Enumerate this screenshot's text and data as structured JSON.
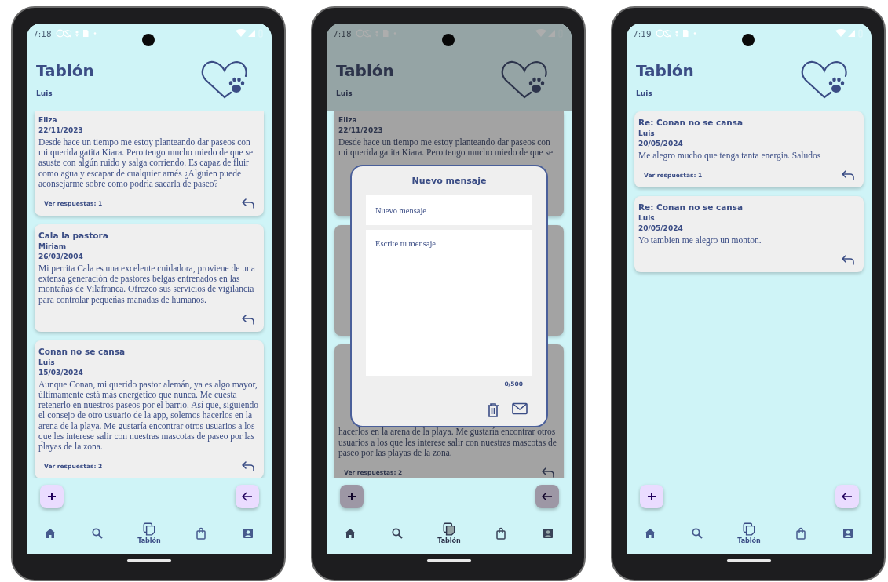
{
  "phones": [
    {
      "status_bar": {
        "time": "7:18"
      },
      "header": {
        "title": "Tablón",
        "user": "Luis"
      },
      "posts": [
        {
          "kind": "full",
          "author": "Eliza",
          "date": "22/11/2023",
          "body": "Desde hace un tiempo me estoy planteando dar paseos con mi querida gatita Kiara. Pero tengo mucho miedo de que se asuste con algún ruido y salga corriendo. Es capaz de fluir como agua y escapar de cualquier arnés ¿Alguien puede aconsejarme sobre como podría sacarla de paseo?",
          "replies": "Ver respuestas: 1"
        },
        {
          "kind": "full",
          "title": "Cala la pastora",
          "author": "Miriam",
          "date": "26/03/2004",
          "body": "Mi perrita Cala es una excelente cuidadora, proviene de una extensa generación de pastores belgas entrenados en las montañas de Vilafranca. Ofrezco sus servicios de vigilancia para controlar pequeñas manadas de humanos."
        },
        {
          "kind": "full",
          "title": "Conan no se cansa",
          "author": "Luis",
          "date": "15/03/2024",
          "body": "Aunque Conan, mi querido pastor alemán, ya es algo mayor, últimamente está más energético que nunca. Me cuesta retenerlo en nuestros paseos por el barrio. Así que, siguiendo el consejo de otro usuario de la app, solemos hacerlos en la arena de la playa. Me gustaría encontrar otros usuarios a los que les interese salir con nuestras mascotas de paseo por las playas de la zona.",
          "replies": "Ver respuestas: 2"
        }
      ],
      "nav": [
        {
          "kind": "home",
          "selected": false
        },
        {
          "kind": "search",
          "selected": false
        },
        {
          "kind": "board",
          "label": "Tablón",
          "selected": true
        },
        {
          "kind": "shop",
          "selected": false
        },
        {
          "kind": "profile",
          "selected": false
        }
      ]
    },
    {
      "status_bar": {
        "time": "7:18"
      },
      "header": {
        "title": "Tablón",
        "user": "Luis"
      },
      "posts": [
        {
          "kind": "top",
          "author": "Eliza",
          "date": "22/11/2023",
          "body": "Desde hace un tiempo me estoy planteando dar paseos con mi querida gatita Kiara. Pero tengo mucho miedo de que se"
        },
        {
          "kind": "covered"
        },
        {
          "kind": "bottom",
          "body": "hacerlos en la arena de la playa. Me gustaría encontrar otros usuarios a los que les interese salir con nuestras mascotas de paseo por las playas de la zona.",
          "replies": "Ver respuestas: 2"
        }
      ],
      "nav": [
        {
          "kind": "home",
          "selected": false
        },
        {
          "kind": "search",
          "selected": false
        },
        {
          "kind": "board",
          "label": "Tablón",
          "selected": true
        },
        {
          "kind": "shop",
          "selected": false
        },
        {
          "kind": "profile",
          "selected": false
        }
      ],
      "dialog": {
        "title": "Nuevo mensaje",
        "fields": [
          {
            "kind": "line",
            "placeholder": "Nuevo mensaje"
          },
          {
            "kind": "area",
            "placeholder": "Escrite tu mensaje"
          }
        ],
        "counter": "0/500"
      }
    },
    {
      "status_bar": {
        "time": "7:19"
      },
      "header": {
        "title": "Tablón",
        "user": "Luis"
      },
      "posts": [
        {
          "kind": "full",
          "title": "Re: Conan no se cansa",
          "author": "Luis",
          "date": "20/05/2024",
          "body": "Me alegro mucho que tenga tanta energia. Saludos",
          "replies": "Ver respuestas: 1"
        },
        {
          "kind": "full",
          "title": "Re: Conan no se cansa",
          "author": "Luis",
          "date": "20/05/2024",
          "body": "Yo tambien me alegro un monton."
        }
      ],
      "nav": [
        {
          "kind": "home",
          "selected": false
        },
        {
          "kind": "search",
          "selected": false
        },
        {
          "kind": "board",
          "label": "Tablón",
          "selected": true
        },
        {
          "kind": "shop",
          "selected": false
        },
        {
          "kind": "profile",
          "selected": false
        }
      ]
    }
  ]
}
